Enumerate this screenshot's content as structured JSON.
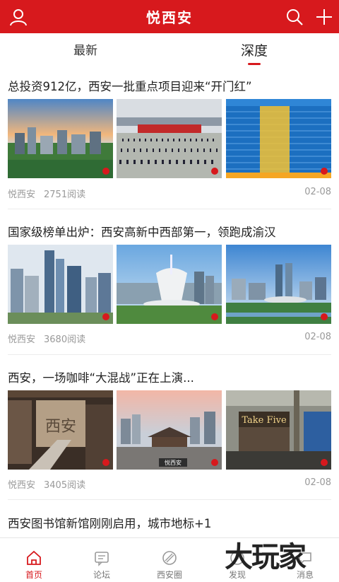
{
  "header": {
    "title": "悦西安",
    "left_icon": "user-icon",
    "right_icons": [
      "search-icon",
      "plus-icon"
    ],
    "brand_color": "#d7191d"
  },
  "tabs": [
    {
      "label": "最新",
      "active": false
    },
    {
      "label": "深度",
      "active": true
    }
  ],
  "articles": [
    {
      "headline": "总投资912亿，西安一批重点项目迎来“开门红”",
      "source": "悦西安",
      "reads": "2751阅读",
      "date": "02-08",
      "thumb_overlay": ""
    },
    {
      "headline": "国家级榜单出炉：西安高新中西部第一，领跑成渝汉",
      "source": "悦西安",
      "reads": "3680阅读",
      "date": "02-08",
      "thumb_overlay": ""
    },
    {
      "headline": "西安，一场咖啡“大混战”正在上演...",
      "source": "悦西安",
      "reads": "3405阅读",
      "date": "02-08",
      "thumb_overlay": "悦西安",
      "thumb_signs": [
        "西安",
        "Take Five"
      ]
    },
    {
      "headline": "西安图书馆新馆刚刚启用，城市地标+1"
    }
  ],
  "bottom_nav": [
    {
      "label": "首页",
      "icon": "home-icon",
      "active": true
    },
    {
      "label": "论坛",
      "icon": "forum-icon",
      "active": false
    },
    {
      "label": "西安圈",
      "icon": "circle-icon",
      "active": false
    },
    {
      "label": "发现",
      "icon": "discover-icon",
      "active": false
    },
    {
      "label": "消息",
      "icon": "message-icon",
      "active": false
    }
  ],
  "watermark": "大玩家"
}
